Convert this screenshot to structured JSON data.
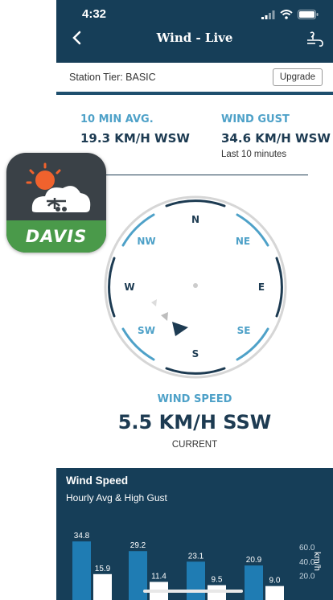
{
  "status_bar": {
    "time": "4:32"
  },
  "header": {
    "title": "Wind - Live"
  },
  "tier": {
    "label": "Station Tier: BASIC",
    "upgrade_label": "Upgrade"
  },
  "stats": {
    "avg_label": "10 MIN AVG.",
    "avg_value": "19.3 KM/H WSW",
    "gust_label": "WIND GUST",
    "gust_value": "34.6 KM/H WSW",
    "gust_sub": "Last 10 minutes"
  },
  "compass": {
    "directions": [
      "N",
      "NE",
      "E",
      "SE",
      "S",
      "SW",
      "W",
      "NW"
    ],
    "arrow_direction": "SSW"
  },
  "wind_speed": {
    "label": "WIND SPEED",
    "value": "5.5 KM/H SSW",
    "sub": "CURRENT"
  },
  "app_icon": {
    "brand": "DAVIS"
  },
  "colors": {
    "header_bg": "#163e58",
    "accent": "#4ea1c8",
    "text_dark": "#1d3b52",
    "app_green": "#4a9a4a"
  },
  "chart_data": {
    "type": "bar",
    "title": "Wind Speed",
    "subtitle": "Hourly Avg & High Gust",
    "ylabel": "km/h",
    "yticks": [
      "60.0",
      "40.0",
      "20.0"
    ],
    "ylim": [
      0,
      60
    ],
    "series": [
      {
        "values": [
          34.8,
          29.2,
          23.1,
          20.9
        ]
      },
      {
        "values": [
          15.9,
          11.4,
          9.5,
          9.0
        ]
      }
    ],
    "data_labels": [
      "34.8",
      "15.9",
      "29.2",
      "11.4",
      "23.1",
      "9.5",
      "20.9",
      "9.0"
    ]
  }
}
